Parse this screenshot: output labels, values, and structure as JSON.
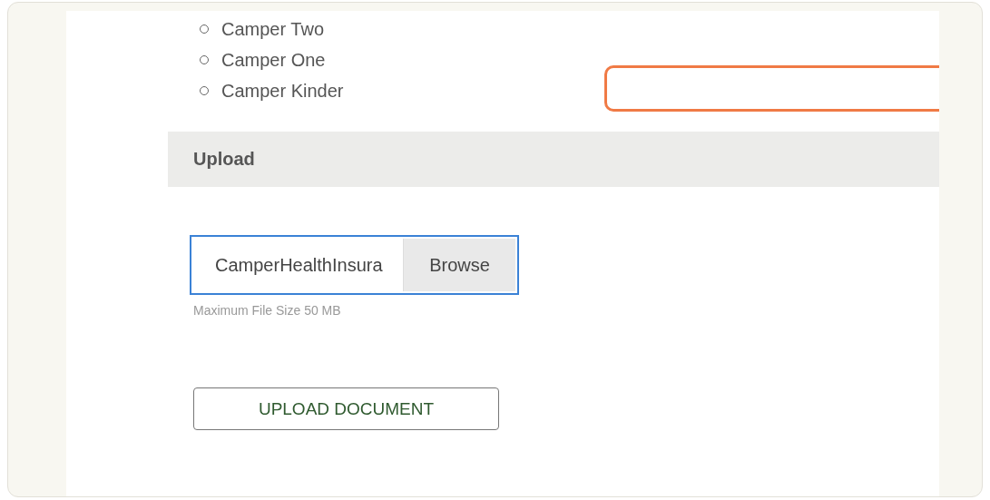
{
  "camper_options": [
    {
      "label": "Camper Two",
      "selected": false
    },
    {
      "label": "Camper One",
      "selected": false
    },
    {
      "label": "Camper Kinder",
      "selected": false
    }
  ],
  "upload": {
    "heading": "Upload",
    "file_field": {
      "value": "CamperHealthInsura",
      "button": "Browse",
      "focused": true
    },
    "hint": "Maximum File Size 50 MB",
    "submit": "UPLOAD DOCUMENT"
  }
}
